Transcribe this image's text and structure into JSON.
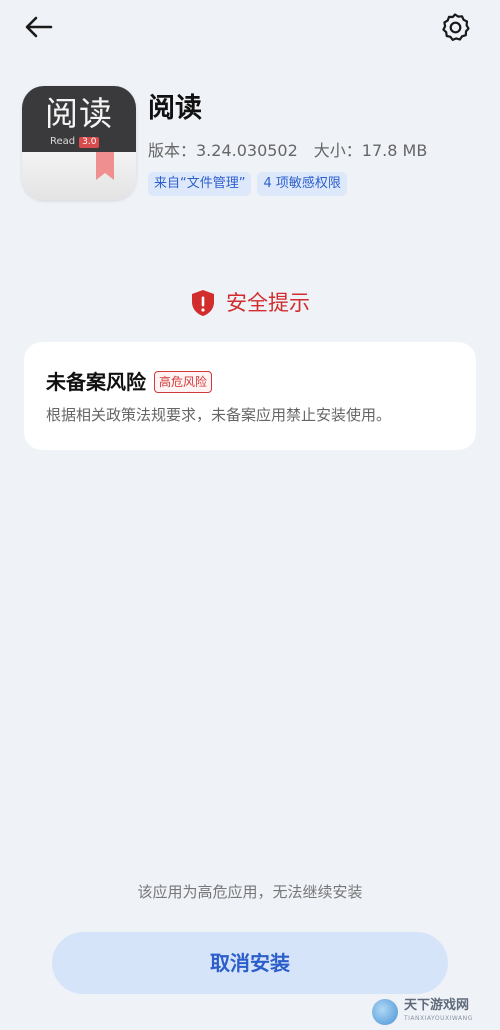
{
  "app": {
    "name": "阅读",
    "icon_title": "阅读",
    "icon_subtitle": "Read",
    "icon_version": "3.0",
    "version_label": "版本：3.24.030502",
    "size_label": "大小：17.8 MB",
    "tags": [
      "来自“文件管理”",
      "4 项敏感权限"
    ]
  },
  "security": {
    "title": "安全提示"
  },
  "risk": {
    "title": "未备案风险",
    "badge": "高危风险",
    "description": "根据相关政策法规要求，未备案应用禁止安装使用。"
  },
  "footer": {
    "note": "该应用为高危应用，无法继续安装",
    "cancel_label": "取消安装"
  },
  "watermark": {
    "main": "天下游戏网",
    "sub": "TIANXIAYOUXIWANG"
  },
  "colors": {
    "background": "#eff2f7",
    "accent": "#2b5ecb",
    "danger": "#d12d2d",
    "button_bg": "#d6e4fa"
  },
  "icons": [
    "back-arrow-icon",
    "gear-icon",
    "shield-alert-icon"
  ]
}
